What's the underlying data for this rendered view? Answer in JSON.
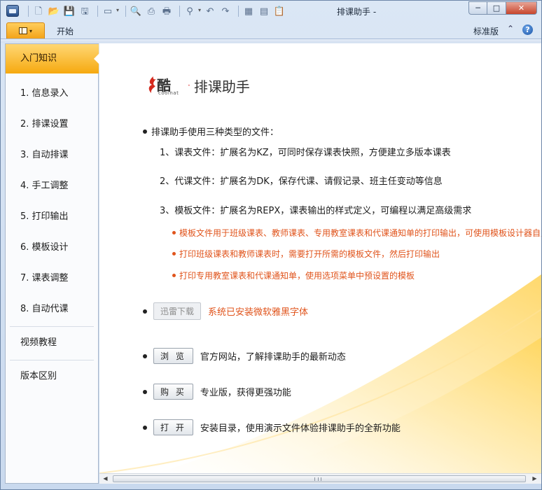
{
  "window": {
    "title": "排课助手 -",
    "controls": {
      "minimize": "─",
      "maximize": "□",
      "close": "✕"
    }
  },
  "quick_access": [
    {
      "icon": "app-menu-icon"
    },
    {
      "icon": "new-file-icon",
      "glyph": "🗋"
    },
    {
      "icon": "open-folder-icon",
      "glyph": "📂"
    },
    {
      "icon": "save-icon",
      "glyph": "💾"
    },
    {
      "icon": "save-as-icon",
      "glyph": "🖫"
    },
    {
      "icon": "window-layout-icon",
      "glyph": "▭"
    },
    {
      "icon": "print-preview-icon",
      "glyph": "🔍"
    },
    {
      "icon": "print-setup-icon",
      "glyph": "⎙"
    },
    {
      "icon": "print-icon",
      "glyph": "🖶"
    },
    {
      "icon": "zoom-icon",
      "glyph": "⚲"
    },
    {
      "icon": "undo-icon",
      "glyph": "↶"
    },
    {
      "icon": "redo-icon",
      "glyph": "↷"
    },
    {
      "icon": "grid-table-icon",
      "glyph": "▦"
    },
    {
      "icon": "grid-merge-icon",
      "glyph": "▤"
    },
    {
      "icon": "clipboard-doc-icon",
      "glyph": "📋"
    }
  ],
  "ribbon": {
    "tabs": [
      {
        "label": "开始"
      }
    ],
    "edition": "标准版",
    "collapse_glyph": "⌃",
    "help_glyph": "?"
  },
  "sidebar": {
    "active": "入门知识",
    "items": [
      {
        "label": "1. 信息录入"
      },
      {
        "label": "2. 排课设置"
      },
      {
        "label": "3. 自动排课"
      },
      {
        "label": "4. 手工调整"
      },
      {
        "label": "5. 打印输出"
      },
      {
        "label": "6. 模板设计"
      },
      {
        "label": "7. 课表调整"
      },
      {
        "label": "8. 自动代课"
      }
    ],
    "extra": [
      {
        "label": "视频教程"
      },
      {
        "label": "版本区别"
      }
    ]
  },
  "logo": {
    "brand_zh": "酷",
    "brand_en": "coolnat",
    "dot": "·",
    "title": "排课助手"
  },
  "intro": {
    "heading": "排课助手使用三种类型的文件：",
    "types": [
      "1、课表文件：扩展名为KZ，可同时保存课表快照，方便建立多版本课表",
      "2、代课文件：扩展名为DK，保存代课、请假记录、班主任变动等信息",
      "3、模板文件：扩展名为REPX，课表输出的样式定义，可编程以满足高级需求"
    ],
    "notes": [
      "模板文件用于班级课表、教师课表、专用教室课表和代课通知单的打印输出，可使用模板设计器自定义样式",
      "打印班级课表和教师课表时，需要打开所需的模板文件，然后打印输出",
      "打印专用教室课表和代课通知单，使用选项菜单中预设置的模板"
    ]
  },
  "actions": {
    "download": {
      "button": "迅雷下载",
      "text": "系统已安装微软雅黑字体"
    },
    "browse": {
      "button": "浏 览",
      "text": "官方网站，了解排课助手的最新动态"
    },
    "buy": {
      "button": "购 买",
      "text": "专业版，获得更强功能"
    },
    "open": {
      "button": "打 开",
      "text": "安装目录，使用演示文件体验排课助手的全新功能"
    }
  },
  "colors": {
    "accent_orange": "#f6a90f",
    "note_orange": "#e0541c",
    "frame_blue": "#c9d9ee"
  }
}
